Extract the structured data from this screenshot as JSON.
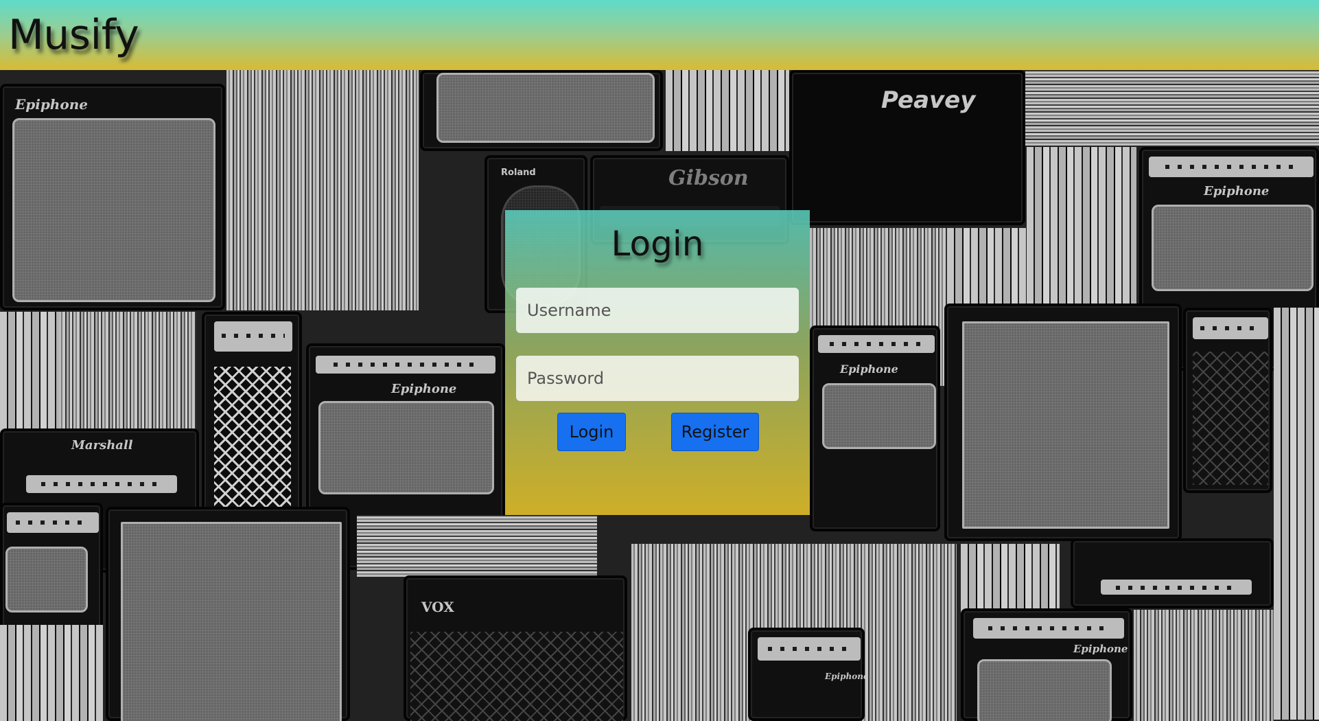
{
  "app": {
    "brand": "Musify"
  },
  "login": {
    "title": "Login",
    "username_placeholder": "Username",
    "password_placeholder": "Password",
    "login_button": "Login",
    "register_button": "Register"
  },
  "background": {
    "amp_brands": [
      "Epiphone",
      "Peavey",
      "Gibson",
      "Roland",
      "Marshall",
      "VOX",
      "Epiphone",
      "Epiphone",
      "Epiphone",
      "Epiphone",
      "Epiphone"
    ]
  },
  "colors": {
    "header_top": "#5fdbc9",
    "header_bottom": "#d8bb35",
    "button": "#1670f0"
  }
}
